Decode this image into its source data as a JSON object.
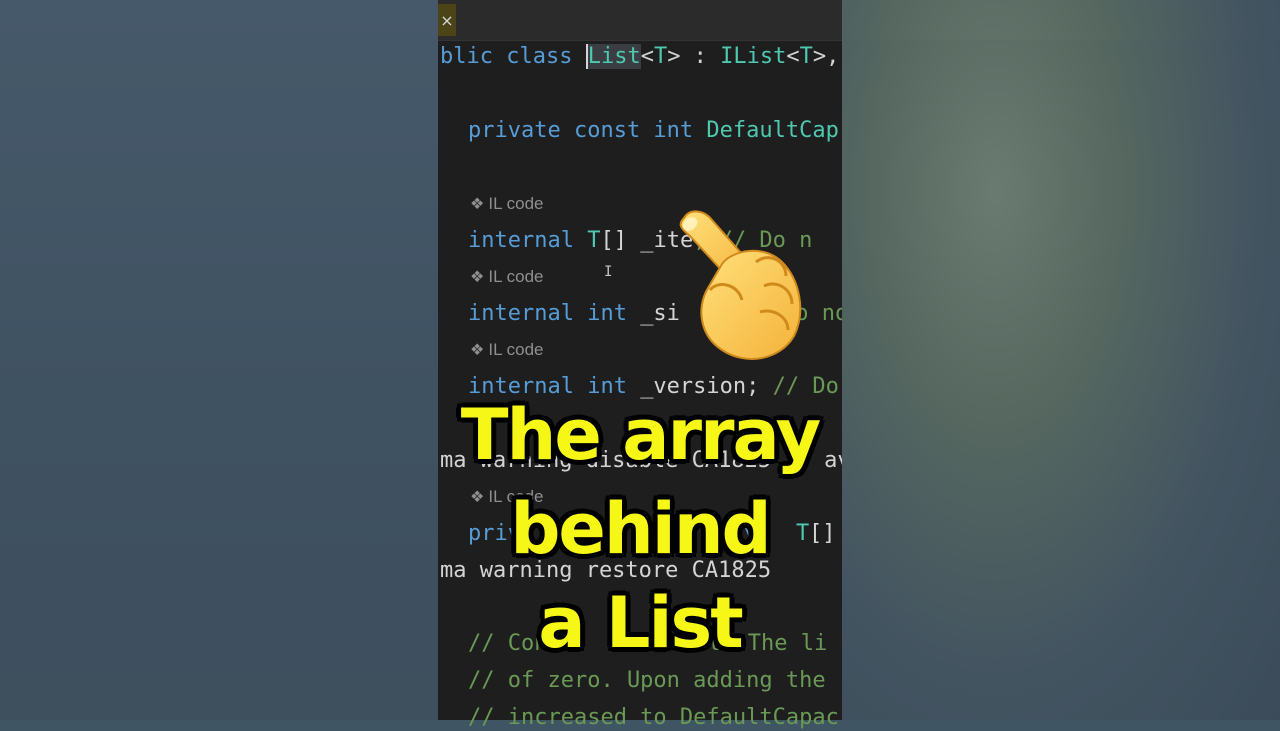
{
  "tab": {
    "close_glyph": "×"
  },
  "code": {
    "line1": {
      "a": "blic class ",
      "b": "List",
      "c": "<",
      "d": "T",
      "e": "> : ",
      "f": "IList",
      "g": "<",
      "h": "T",
      "i": ">,"
    },
    "line2": {
      "a": "private const int ",
      "b": "DefaultCap"
    },
    "line3": {
      "a": "internal ",
      "b": "T",
      "c": "[] _ite",
      "d": "; // Do n"
    },
    "line4": {
      "a": "internal int ",
      "b": "_si",
      "c": "Do no"
    },
    "line5": {
      "a": "internal int ",
      "b": "_version; ",
      "c": "// Do"
    },
    "line6": {
      "a": "ma warning disable CA1825 // av"
    },
    "line7": {
      "a": "priv",
      "b": "y ",
      "c": "T",
      "d": "[]"
    },
    "line8": {
      "a": "ma warning restore CA1825"
    },
    "line9": {
      "a": "// Con",
      "b": "t. The li"
    },
    "line10": {
      "a": "// of zero. Upon adding the"
    },
    "line11": {
      "a": "// increased to DefaultCapac"
    }
  },
  "codelens": {
    "label": "IL code",
    "icon": "diamond-icon"
  },
  "overlay": {
    "line1": "The array",
    "line2": "behind",
    "line3": "a List"
  },
  "colors": {
    "keyword": "#569cd6",
    "type": "#4ec9b0",
    "comment": "#6a9955",
    "overlay_text": "#f7f717"
  }
}
